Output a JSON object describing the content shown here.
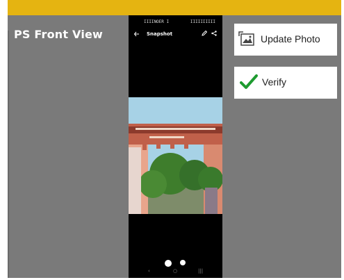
{
  "header": {
    "accent_color": "#e5b411"
  },
  "section": {
    "title": "PS Front View"
  },
  "phone": {
    "status": {
      "left": "IIIINOER I",
      "right": "IIIIIIIIII"
    },
    "app_bar": {
      "title": "Snapshot",
      "back_icon": "back-arrow-icon",
      "edit_icon": "pencil-icon",
      "share_icon": "share-icon"
    }
  },
  "actions": {
    "update_photo": {
      "label": "Update Photo",
      "icon": "image-replace-icon"
    },
    "verify": {
      "label": "Verify",
      "icon": "checkmark-icon",
      "icon_color": "#1e9b30"
    }
  },
  "colors": {
    "panel": "#7a7a7a",
    "button_bg": "#ffffff"
  }
}
